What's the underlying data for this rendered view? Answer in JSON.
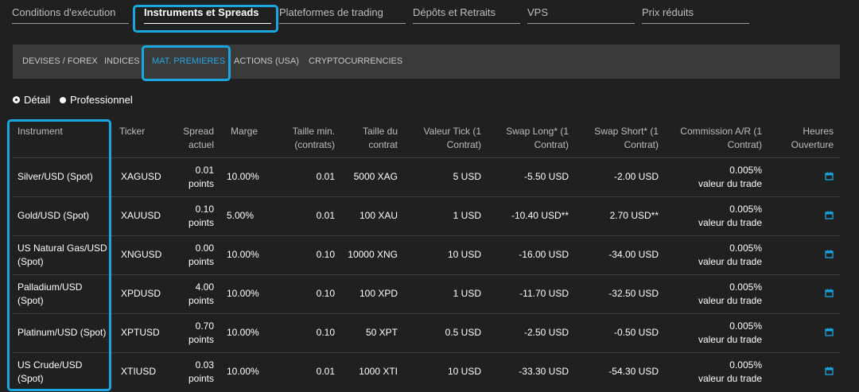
{
  "top_tabs": [
    {
      "label": "Conditions d'exécution"
    },
    {
      "label": "Instruments et Spreads"
    },
    {
      "label": "Plateformes de trading"
    },
    {
      "label": "Dépôts et Retraits"
    },
    {
      "label": "VPS"
    },
    {
      "label": "Prix réduits"
    }
  ],
  "sub_tabs": [
    {
      "label": "DEVISES / FOREX"
    },
    {
      "label": "INDICES"
    },
    {
      "label": "MAT. PREMIERES"
    },
    {
      "label": "ACTIONS (USA)"
    },
    {
      "label": "CRYPTOCURRENCIES"
    }
  ],
  "radios": [
    {
      "label": "Détail"
    },
    {
      "label": "Professionnel"
    }
  ],
  "columns": [
    [
      "Instrument"
    ],
    [
      "Ticker"
    ],
    [
      "Spread",
      "actuel"
    ],
    [
      "Marge"
    ],
    [
      "Taille min.",
      "(contrats)"
    ],
    [
      "Taille du",
      "contrat"
    ],
    [
      "Valeur Tick (1",
      "Contrat)"
    ],
    [
      "Swap Long* (1",
      "Contrat)"
    ],
    [
      "Swap Short* (1",
      "Contrat)"
    ],
    [
      "Commission A/R (1",
      "Contrat)"
    ],
    [
      "Heures",
      "Ouverture"
    ]
  ],
  "rows": [
    {
      "instrument": [
        "Silver/USD (Spot)"
      ],
      "ticker": "XAGUSD",
      "spread": [
        "0.01",
        "points"
      ],
      "marge": "10.00%",
      "taille_min": "0.01",
      "taille": "5000 XAG",
      "tick": "5 USD",
      "swap_long": "-5.50 USD",
      "swap_short": "-2.00 USD",
      "commission": [
        "0.005%",
        "valeur du trade"
      ]
    },
    {
      "instrument": [
        "Gold/USD (Spot)"
      ],
      "ticker": "XAUUSD",
      "spread": [
        "0.10",
        "points"
      ],
      "marge": "5.00%",
      "taille_min": "0.01",
      "taille": "100 XAU",
      "tick": "1 USD",
      "swap_long": "-10.40 USD**",
      "swap_short": "2.70 USD**",
      "commission": [
        "0.005%",
        "valeur du trade"
      ]
    },
    {
      "instrument": [
        "US Natural Gas/USD",
        "(Spot)"
      ],
      "ticker": "XNGUSD",
      "spread": [
        "0.00",
        "points"
      ],
      "marge": "10.00%",
      "taille_min": "0.10",
      "taille": "10000 XNG",
      "tick": "10 USD",
      "swap_long": "-16.00 USD",
      "swap_short": "-34.00 USD",
      "commission": [
        "0.005%",
        "valeur du trade"
      ]
    },
    {
      "instrument": [
        "Palladium/USD",
        "(Spot)"
      ],
      "ticker": "XPDUSD",
      "spread": [
        "4.00",
        "points"
      ],
      "marge": "10.00%",
      "taille_min": "0.10",
      "taille": "100 XPD",
      "tick": "1 USD",
      "swap_long": "-11.70 USD",
      "swap_short": "-32.50 USD",
      "commission": [
        "0.005%",
        "valeur du trade"
      ]
    },
    {
      "instrument": [
        "Platinum/USD (Spot)"
      ],
      "ticker": "XPTUSD",
      "spread": [
        "0.70",
        "points"
      ],
      "marge": "10.00%",
      "taille_min": "0.10",
      "taille": "50 XPT",
      "tick": "0.5 USD",
      "swap_long": "-2.50 USD",
      "swap_short": "-0.50 USD",
      "commission": [
        "0.005%",
        "valeur du trade"
      ]
    },
    {
      "instrument": [
        "US Crude/USD",
        "(Spot)"
      ],
      "ticker": "XTIUSD",
      "spread": [
        "0.03",
        "points"
      ],
      "marge": "10.00%",
      "taille_min": "0.01",
      "taille": "1000 XTI",
      "tick": "10 USD",
      "swap_long": "-33.30 USD",
      "swap_short": "-54.30 USD",
      "commission": [
        "0.005%",
        "valeur du trade"
      ]
    }
  ],
  "colors": {
    "accent": "#18a7e0",
    "background": "#202020",
    "subnav": "#3a3a3a",
    "active_subtab": "#29a8e0"
  }
}
